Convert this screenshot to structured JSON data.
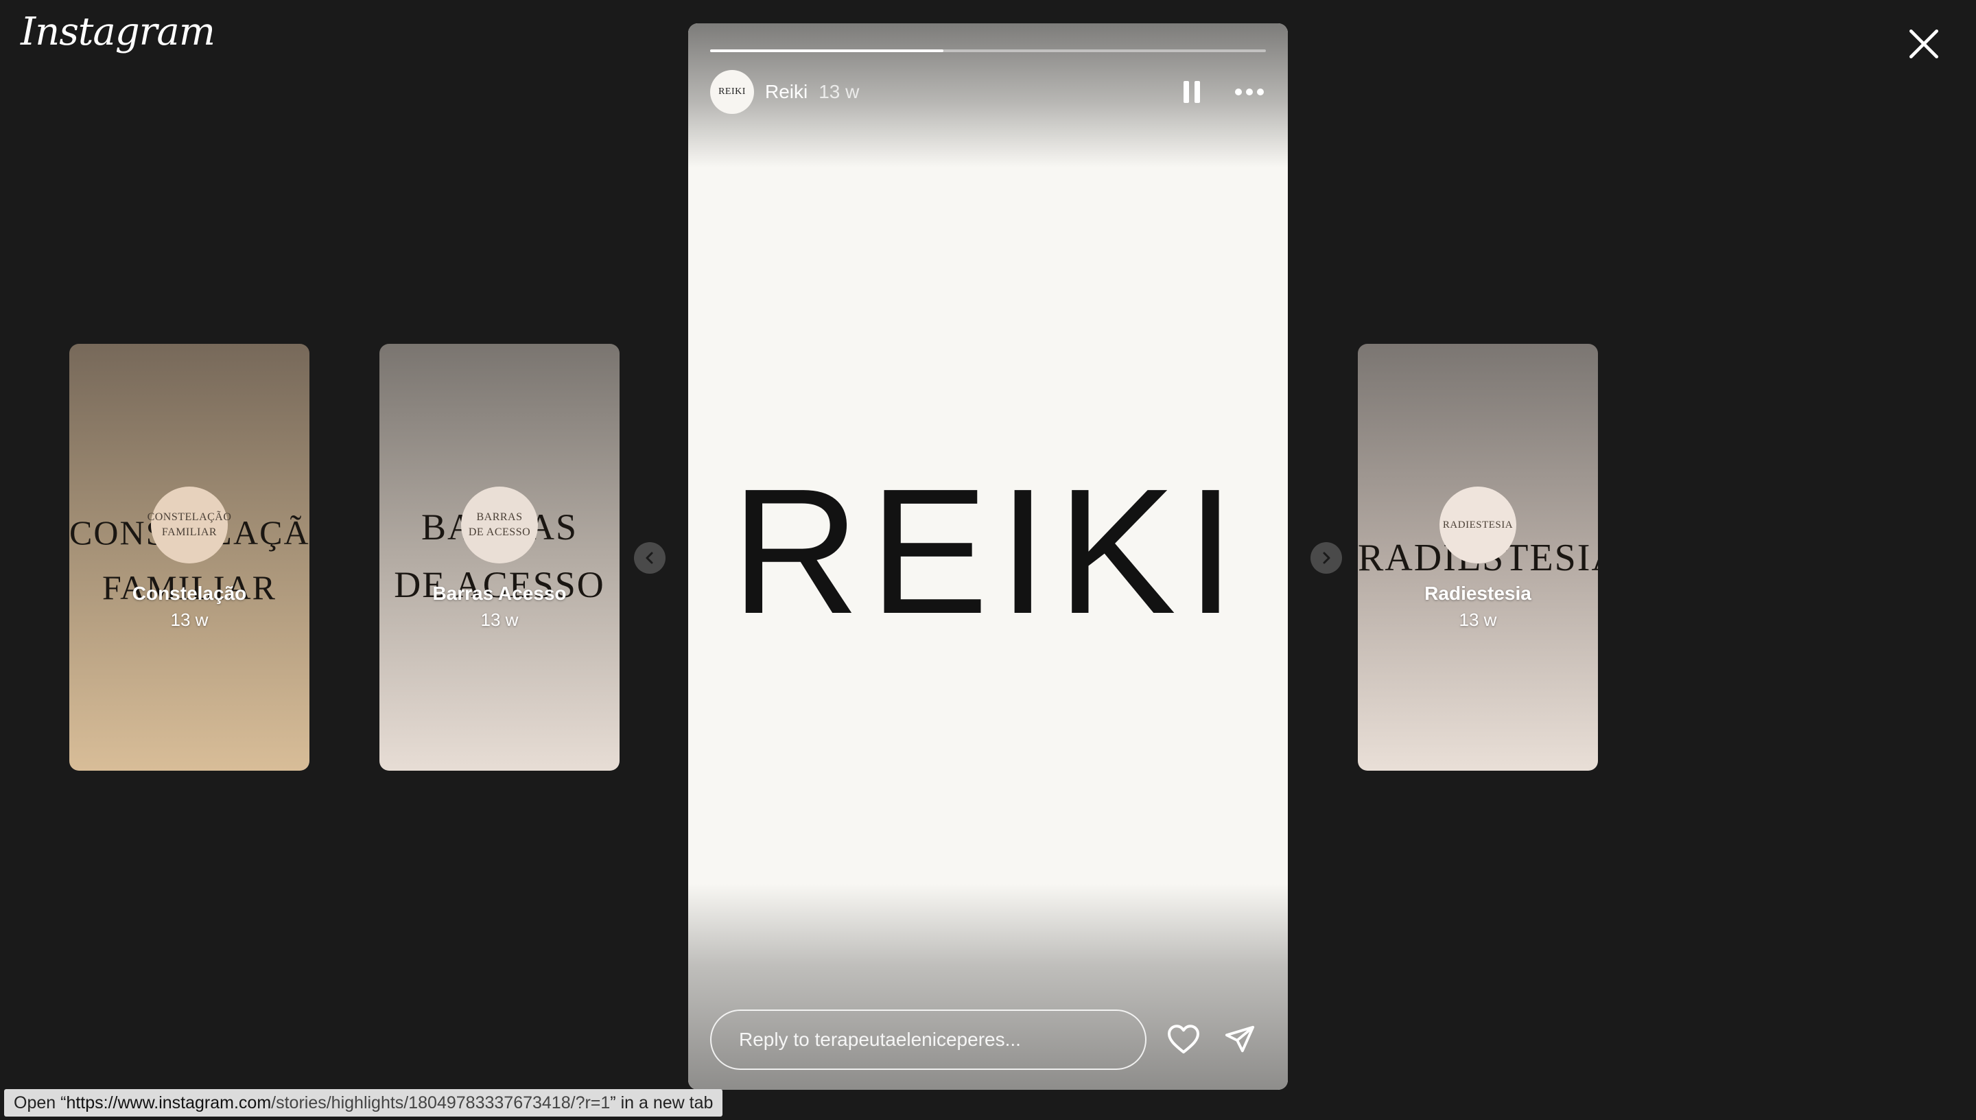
{
  "app": {
    "logo": "Instagram"
  },
  "close": {
    "icon": "close-icon"
  },
  "previews": [
    {
      "name": "Constelação",
      "time": "13 w",
      "bg_line1": "CONSTELAÇÃO",
      "bg_line2": "FAMILIAR",
      "avatar_line1": "CONSTELAÇÃO",
      "avatar_line2": "FAMILIAR"
    },
    {
      "name": "Barras Acesso",
      "time": "13 w",
      "bg_line1": "BARRAS",
      "bg_line2": "DE ACESSO",
      "avatar_line1": "BARRAS",
      "avatar_line2": "DE ACESSO"
    },
    {
      "name": "Radiestesia",
      "time": "13 w",
      "bg_line1": "RADIESTESIA",
      "avatar_line1": "RADIESTESIA"
    }
  ],
  "story": {
    "progress_fraction": 0.42,
    "avatar_text": "REIKI",
    "user": "Reiki",
    "time": "13 w",
    "main_text": "REIKI",
    "reply_placeholder": "Reply to terapeutaeleniceperes..."
  },
  "status": {
    "prefix": "Open “",
    "url_host": "https://www.instagram.com",
    "url_path": "/stories/highlights/18049783337673418/?r=1",
    "suffix": "” in a new tab"
  },
  "colors": {
    "background": "#1a1a1a",
    "story_bg": "#f8f7f3"
  }
}
